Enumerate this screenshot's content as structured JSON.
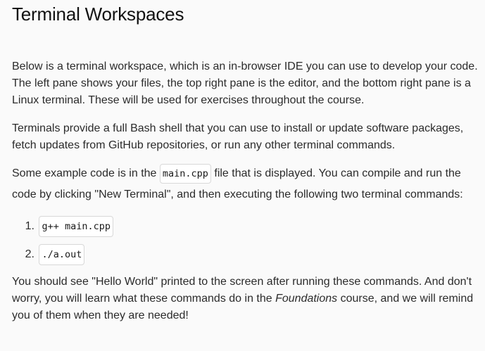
{
  "page": {
    "title": "Terminal Workspaces",
    "para1": "Below is a terminal workspace, which is an in-browser IDE you can use to develop your code. The left pane shows your files, the top right pane is the editor, and the bottom right pane is a Linux terminal. These will be used for exercises throughout the course.",
    "para2": "Terminals provide a full Bash shell that you can use to install or update software packages, fetch updates from GitHub repositories, or run any other terminal commands.",
    "para3": {
      "before": "Some example code is in the ",
      "code": "main.cpp",
      "after": " file that is displayed. You can compile and run the code by clicking \"New Terminal\", and then executing the following two terminal commands:"
    },
    "steps": [
      {
        "number": "1.",
        "command": "g++ main.cpp"
      },
      {
        "number": "2.",
        "command": "./a.out"
      }
    ],
    "para4": {
      "before": "You should see \"Hello World\" printed to the screen after running these commands. And don't worry, you will learn what these commands do in the ",
      "emphasis": "Foundations",
      "after": " course, and we will remind you of them when they are needed!"
    }
  }
}
